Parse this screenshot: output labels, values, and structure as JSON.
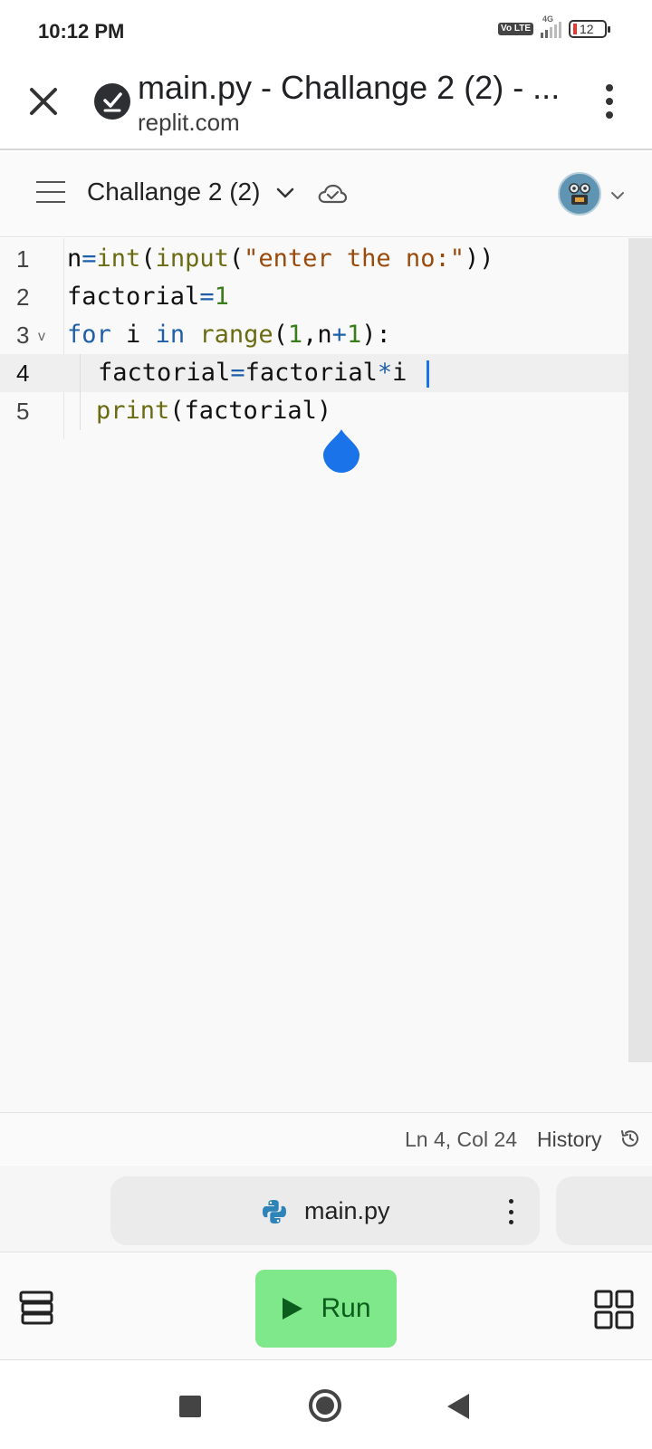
{
  "status_bar": {
    "time": "10:12 PM",
    "volte": "Vo LTE",
    "network": "4G",
    "battery": "12"
  },
  "browser": {
    "title": "main.py - Challange 2 (2) - ...",
    "domain": "replit.com"
  },
  "repl": {
    "name": "Challange 2 (2)"
  },
  "editor": {
    "lines": [
      {
        "no": "1",
        "tokens": [
          "n",
          "=",
          "int",
          "(",
          "input",
          "(",
          "\"enter the no:\"",
          "))"
        ]
      },
      {
        "no": "2",
        "tokens": [
          "factorial",
          "=",
          "1"
        ]
      },
      {
        "no": "3",
        "tokens": [
          "for",
          " i ",
          "in",
          " ",
          "range",
          "(",
          "1",
          ",n",
          "+",
          "1",
          "):"
        ]
      },
      {
        "no": "4",
        "tokens": [
          "factorial",
          "=",
          "factorial",
          "*",
          "i"
        ]
      },
      {
        "no": "5",
        "tokens": [
          "print",
          "(factorial)"
        ]
      }
    ],
    "active_line": 4
  },
  "status": {
    "cursor_position": "Ln 4, Col 24",
    "history_label": "History"
  },
  "file_tabs": [
    {
      "name": "main.py"
    }
  ],
  "toolbar": {
    "run_label": "Run"
  },
  "colors": {
    "run_button": "#7ee88a",
    "keyword": "#1d5fa8",
    "string": "#9a4a0a",
    "number": "#3a7d1b",
    "cursor": "#1a73e8"
  }
}
